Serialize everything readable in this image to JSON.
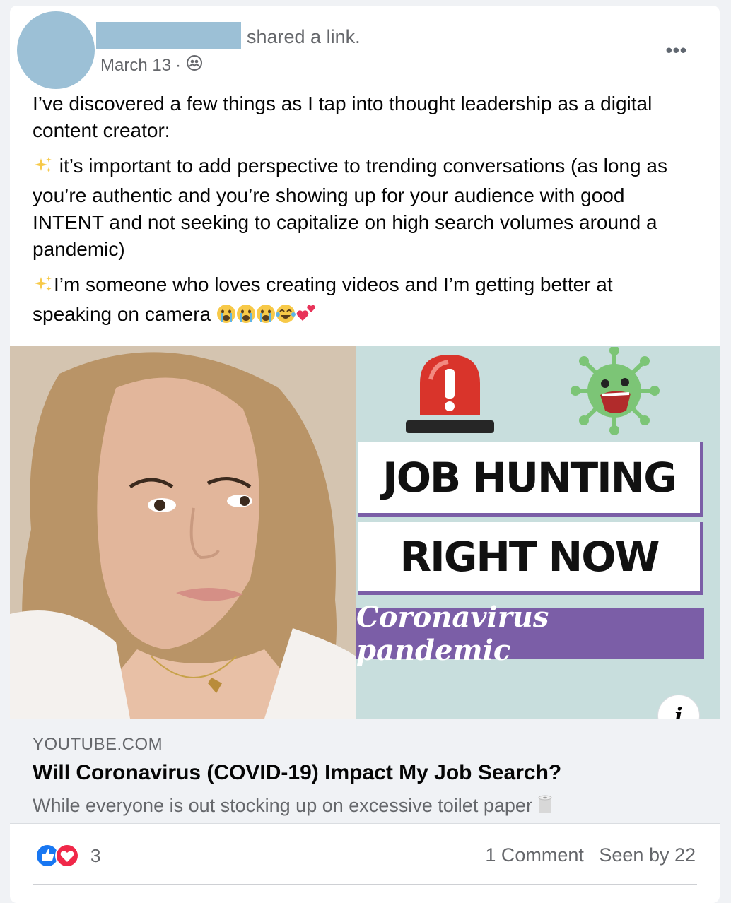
{
  "post": {
    "action": "shared a link.",
    "date": "March 13",
    "date_separator": "·",
    "privacy_icon": "group-icon",
    "more_label": "•••",
    "paragraphs": [
      "I’ve discovered a few things as I tap into thought leadership as a digital content creator:",
      "it’s important to add perspective to trending conversations (as long as you’re authentic and you’re showing up for your audience with good INTENT and not seeking to capitalize on high search volumes around a pandemic)",
      "I’m someone who loves creating videos and I’m getting better at speaking on camera"
    ],
    "emoji_names": [
      "sparkles-icon",
      "crying-face-icon",
      "tears-of-joy-icon",
      "two-hearts-icon"
    ]
  },
  "link": {
    "image": {
      "line1": "JOB HUNTING",
      "line2": "RIGHT NOW",
      "line3": "Coronavirus pandemic",
      "colors": {
        "background": "#c8dedd",
        "accent": "#7b5ea7",
        "siren": "#d9342b",
        "virus": "#7cc576"
      }
    },
    "info_label": "i",
    "domain": "YOUTUBE.COM",
    "title": "Will Coronavirus (COVID-19) Impact My Job Search?",
    "description": "While everyone is out stocking up on excessive toilet paper"
  },
  "footer": {
    "reaction_icons": [
      "like-icon",
      "love-icon"
    ],
    "reaction_count": "3",
    "comments": "1 Comment",
    "seen_by": "Seen by 22"
  }
}
